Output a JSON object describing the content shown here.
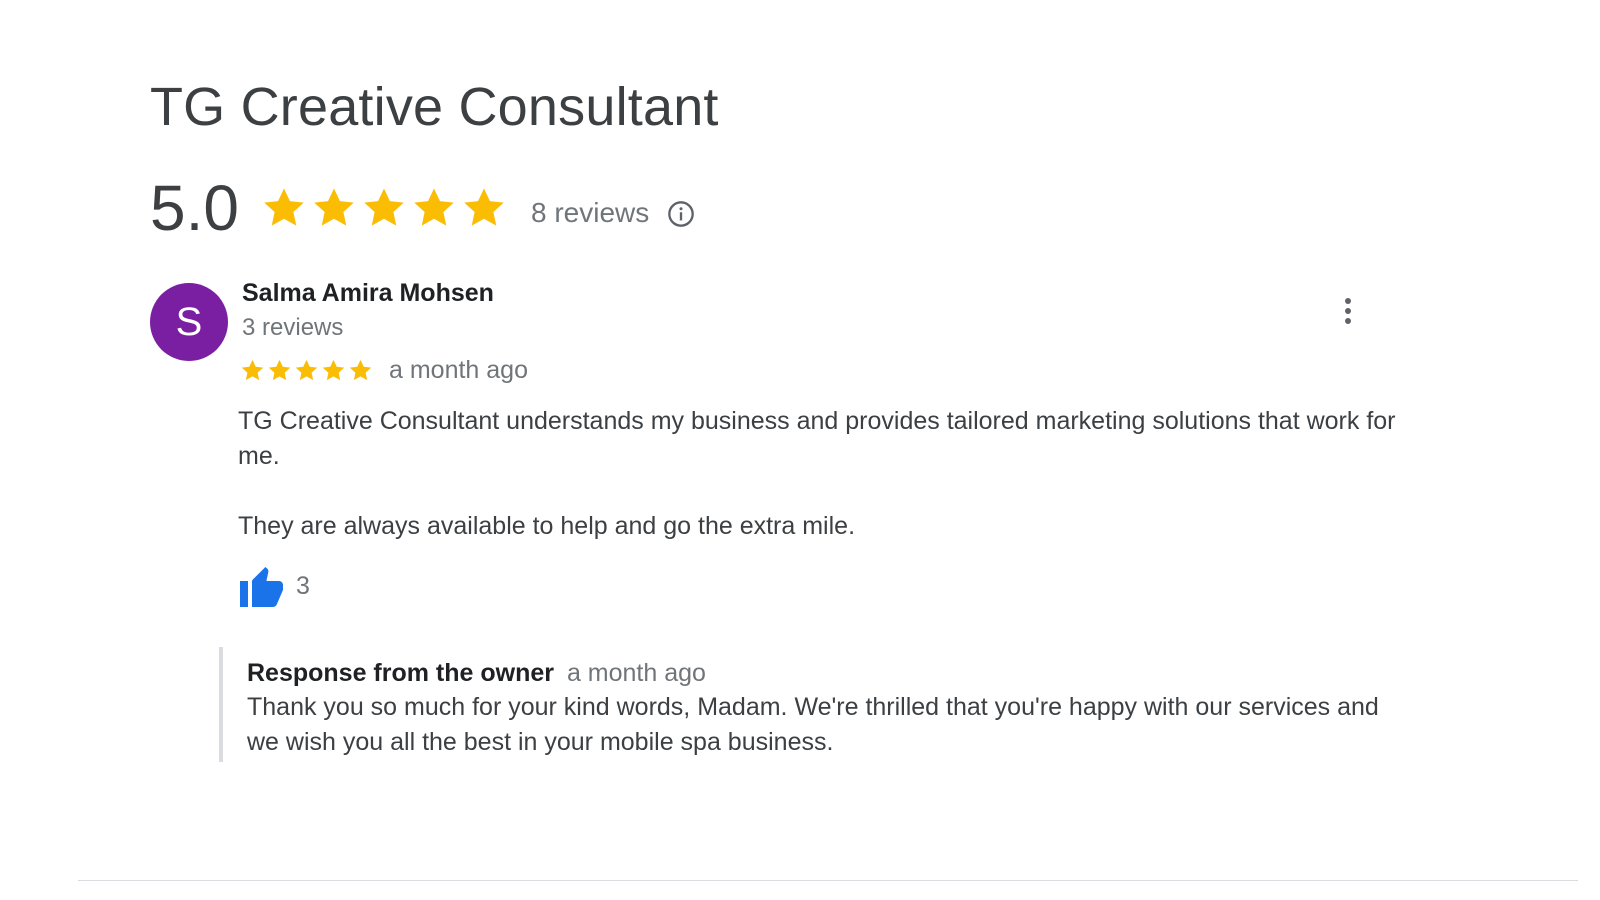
{
  "business": {
    "name": "TG Creative Consultant",
    "rating": "5.0",
    "stars": 5,
    "review_count_label": "8 reviews"
  },
  "icons": {
    "star": "star-icon",
    "info": "info-icon",
    "more": "more-vert-icon",
    "thumb": "thumb-up-icon"
  },
  "colors": {
    "star": "#fbbc04",
    "avatar": "#7b1fa2",
    "thumb": "#1a73e8"
  },
  "review": {
    "avatar_letter": "S",
    "reviewer_name": "Salma Amira Mohsen",
    "reviewer_review_count": "3 reviews",
    "stars": 5,
    "time": "a month ago",
    "paragraphs": [
      "TG Creative Consultant understands my business and provides tailored marketing solutions that work for me.",
      "They are always available to help and go the extra mile."
    ],
    "likes": "3"
  },
  "owner_response": {
    "label": "Response from the owner",
    "time": "a month ago",
    "text": "Thank you so much for your kind words, Madam. We're thrilled that you're happy with our services and we wish you all the best in your mobile spa business."
  }
}
